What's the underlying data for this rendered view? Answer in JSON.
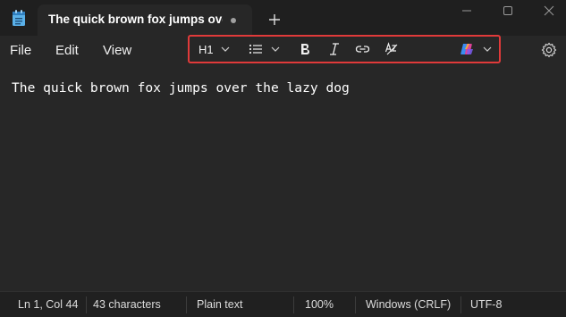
{
  "tab": {
    "title": "The quick brown fox jumps over"
  },
  "menu": {
    "file": "File",
    "edit": "Edit",
    "view": "View"
  },
  "toolbar": {
    "heading_label": "H1",
    "icons": [
      "chevron-down-icon",
      "list-icon",
      "bold-icon",
      "italic-icon",
      "link-icon",
      "clear-formatting-icon",
      "copilot-icon",
      "settings-icon"
    ]
  },
  "editor": {
    "content": "The quick brown fox jumps over the lazy dog"
  },
  "status": {
    "position": "Ln 1, Col 44",
    "characters": "43 characters",
    "format": "Plain text",
    "zoom": "100%",
    "line_ending": "Windows (CRLF)",
    "encoding": "UTF-8"
  },
  "colors": {
    "highlight_border": "#e03a3a",
    "background": "#272727",
    "titlebar": "#1f1f1f"
  }
}
